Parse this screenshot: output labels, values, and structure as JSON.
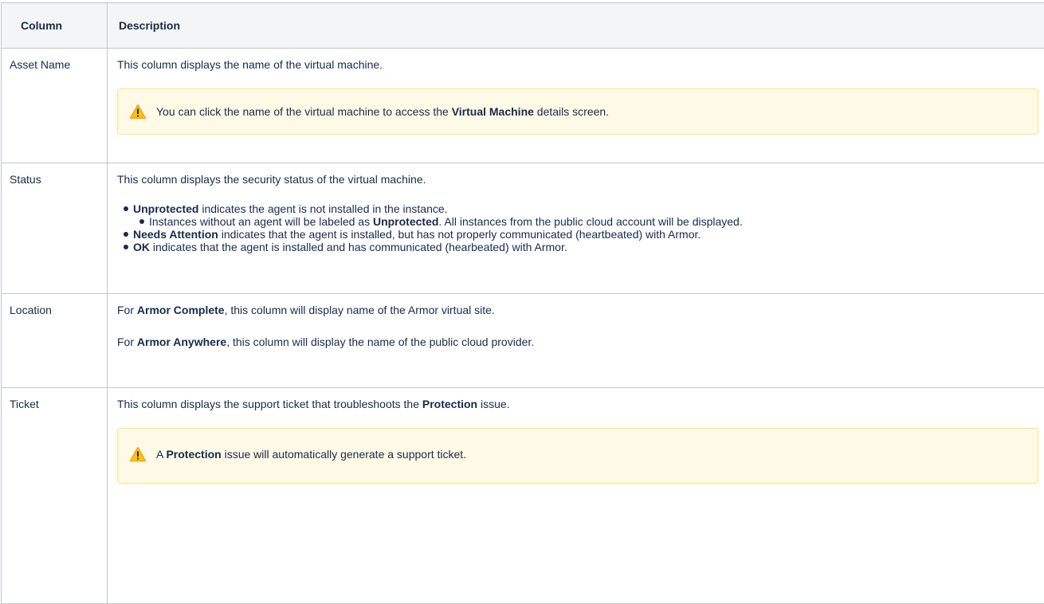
{
  "table": {
    "headers": {
      "column": "Column",
      "description": "Description"
    },
    "rows": {
      "asset": {
        "name": "Asset Name",
        "desc": "This column displays the name of the virtual machine.",
        "note": {
          "icon": "warning-icon",
          "before": "You can click the name of the virtual machine to access the ",
          "bold": "Virtual Machine",
          "after": " details screen."
        }
      },
      "status": {
        "name": "Status",
        "desc": "This column displays the security status of the virtual machine.",
        "items": [
          {
            "bold": "Unprotected",
            "text": " indicates the agent is not installed in the instance."
          },
          {
            "bold": "Needs Attention",
            "text": " indicates that the agent is installed, but has not properly communicated (heartbeated) with Armor."
          },
          {
            "bold": "OK",
            "text": " indicates that the agent is installed and has communicated (hearbeated) with Armor."
          }
        ],
        "sub_item": {
          "before": "Instances without an agent will be labeled as ",
          "bold": "Unprotected",
          "after": ". All instances from the public cloud account will be displayed."
        }
      },
      "location": {
        "name": "Location",
        "para1": {
          "before": "For ",
          "bold": "Armor Complete",
          "after": ", this column will display name of the Armor virtual site."
        },
        "para2": {
          "before": "For ",
          "bold": "Armor Anywhere",
          "after": ", this column will display the name of the public cloud provider."
        }
      },
      "ticket": {
        "name": "Ticket",
        "desc": {
          "before": "This column displays the support ticket that troubleshoots the ",
          "bold": "Protection",
          "after": " issue."
        },
        "note": {
          "icon": "warning-icon",
          "before": "A ",
          "bold": "Protection",
          "after": " issue will automatically generate a support ticket."
        }
      }
    }
  },
  "colors": {
    "header_bg": "#f4f5f7",
    "border": "#c1c7d0",
    "note_bg": "#fffae6",
    "note_border": "#ffe380",
    "warning_icon": "#ff991f"
  }
}
